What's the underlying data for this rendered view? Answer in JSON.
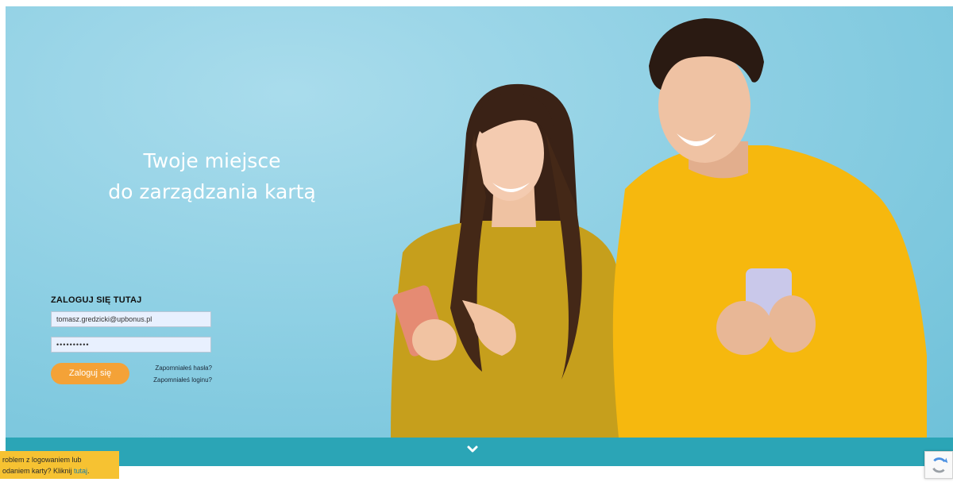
{
  "hero": {
    "headline_line1": "Twoje miejsce",
    "headline_line2": "do zarządzania kartą"
  },
  "login": {
    "title": "ZALOGUJ SIĘ TUTAJ",
    "login_value": "tomasz.gredzicki@upbonus.pl",
    "password_value": "••••••••••",
    "button_label": "Zaloguj się",
    "forgot_password": "Zapomniałeś hasła?",
    "forgot_login": "Zapomniałeś loginu?"
  },
  "notice": {
    "line1": "roblem z logowaniem lub",
    "line2_prefix": "odaniem karty? Kliknij ",
    "link": "tutaj",
    "suffix": "."
  },
  "colors": {
    "accent": "#f4a237",
    "bar": "#2ba5b6",
    "notice": "#f6c232",
    "shirt": "#f6b80e",
    "shirt_woman": "#c9a21a"
  },
  "icons": {
    "scroll": "chevron-down-icon",
    "captcha": "recaptcha-icon"
  }
}
